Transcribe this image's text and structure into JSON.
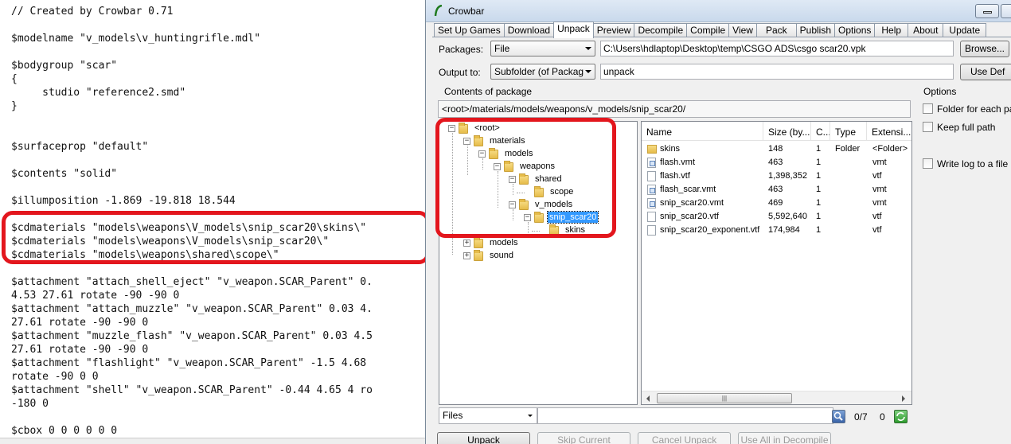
{
  "editor": {
    "lines": [
      "// Created by Crowbar 0.71",
      "$modelname \"v_models\\v_huntingrifle.mdl\"",
      "$bodygroup \"scar\"",
      "{",
      "     studio \"reference2.smd\"",
      "}",
      "$surfaceprop \"default\"",
      "$contents \"solid\"",
      "$illumposition -1.869 -19.818 18.544",
      "$cdmaterials \"models\\weapons\\V_models\\snip_scar20\\skins\\\"",
      "$cdmaterials \"models\\weapons\\V_models\\snip_scar20\\\"",
      "$cdmaterials \"models\\weapons\\shared\\scope\\\"",
      "$attachment \"attach_shell_eject\" \"v_weapon.SCAR_Parent\" 0.",
      "4.53 27.61 rotate -90 -90 0",
      "$attachment \"attach_muzzle\" \"v_weapon.SCAR_Parent\" 0.03 4.",
      "27.61 rotate -90 -90 0",
      "$attachment \"muzzle_flash\" \"v_weapon.SCAR_Parent\" 0.03 4.5",
      "27.61 rotate -90 -90 0",
      "$attachment \"flashlight\" \"v_weapon.SCAR_Parent\" -1.5 4.68",
      "rotate -90 0 0",
      "$attachment \"shell\" \"v_weapon.SCAR_Parent\" -0.44 4.65 4 ro",
      "-180 0",
      "$cbox 0 0 0 0 0 0"
    ]
  },
  "window": {
    "title": "Crowbar",
    "tabs": [
      "Set Up Games",
      "Download",
      "Unpack",
      "Preview",
      "Decompile",
      "Compile",
      "View",
      "Pack",
      "Publish",
      "Options",
      "Help",
      "About",
      "Update"
    ],
    "active_tab": "Unpack"
  },
  "unpack": {
    "packages_label": "Packages:",
    "packages_mode": "File",
    "packages_path": "C:\\Users\\hdlaptop\\Desktop\\temp\\CSGO ADS\\csgo scar20.vpk",
    "browse_label": "Browse...",
    "output_label": "Output to:",
    "output_mode": "Subfolder (of Packag",
    "output_value": "unpack",
    "use_default_label": "Use Def",
    "contents_label": "Contents of package",
    "current_path": "<root>/materials/models/weapons/v_models/snip_scar20/",
    "tree": [
      {
        "label": "<root>",
        "expander": "−"
      },
      {
        "label": "materials",
        "expander": "−"
      },
      {
        "label": "models",
        "expander": "−"
      },
      {
        "label": "weapons",
        "expander": "−"
      },
      {
        "label": "shared",
        "expander": "−"
      },
      {
        "label": "scope",
        "expander": ""
      },
      {
        "label": "v_models",
        "expander": "−"
      },
      {
        "label": "snip_scar20",
        "expander": "−",
        "selected": true
      },
      {
        "label": "skins",
        "expander": ""
      },
      {
        "label": "models",
        "expander": "+"
      },
      {
        "label": "sound",
        "expander": "+"
      }
    ],
    "columns": [
      "Name",
      "Size (by...",
      "C...",
      "Type",
      "Extensi..."
    ],
    "files": [
      {
        "name": "skins",
        "size": "148",
        "count": "1",
        "type": "Folder",
        "ext": "<Folder>",
        "icon": "folder-icon"
      },
      {
        "name": "flash.vmt",
        "size": "463",
        "count": "1",
        "type": "",
        "ext": "vmt",
        "icon": "vmt-file-icon"
      },
      {
        "name": "flash.vtf",
        "size": "1,398,352",
        "count": "1",
        "type": "",
        "ext": "vtf",
        "icon": "file-icon"
      },
      {
        "name": "flash_scar.vmt",
        "size": "463",
        "count": "1",
        "type": "",
        "ext": "vmt",
        "icon": "vmt-file-icon"
      },
      {
        "name": "snip_scar20.vmt",
        "size": "469",
        "count": "1",
        "type": "",
        "ext": "vmt",
        "icon": "vmt-file-icon"
      },
      {
        "name": "snip_scar20.vtf",
        "size": "5,592,640",
        "count": "1",
        "type": "",
        "ext": "vtf",
        "icon": "file-icon"
      },
      {
        "name": "snip_scar20_exponent.vtf",
        "size": "174,984",
        "count": "1",
        "type": "",
        "ext": "vtf",
        "icon": "file-icon"
      }
    ],
    "filter": "Files",
    "selection_count": "0/7",
    "selection_size": "0",
    "buttons": {
      "unpack": "Unpack",
      "skip_current": "Skip Current",
      "cancel_unpack": "Cancel Unpack",
      "use_all": "Use All in Decompile"
    }
  },
  "options": {
    "title": "Options",
    "folder_for_each": "Folder for each pa",
    "keep_full_path": "Keep full path",
    "write_log": "Write log to a file"
  },
  "colors": {
    "highlight_red": "#e3161d",
    "selection_blue": "#3399ff",
    "window_bg": "#f0f0f0"
  }
}
